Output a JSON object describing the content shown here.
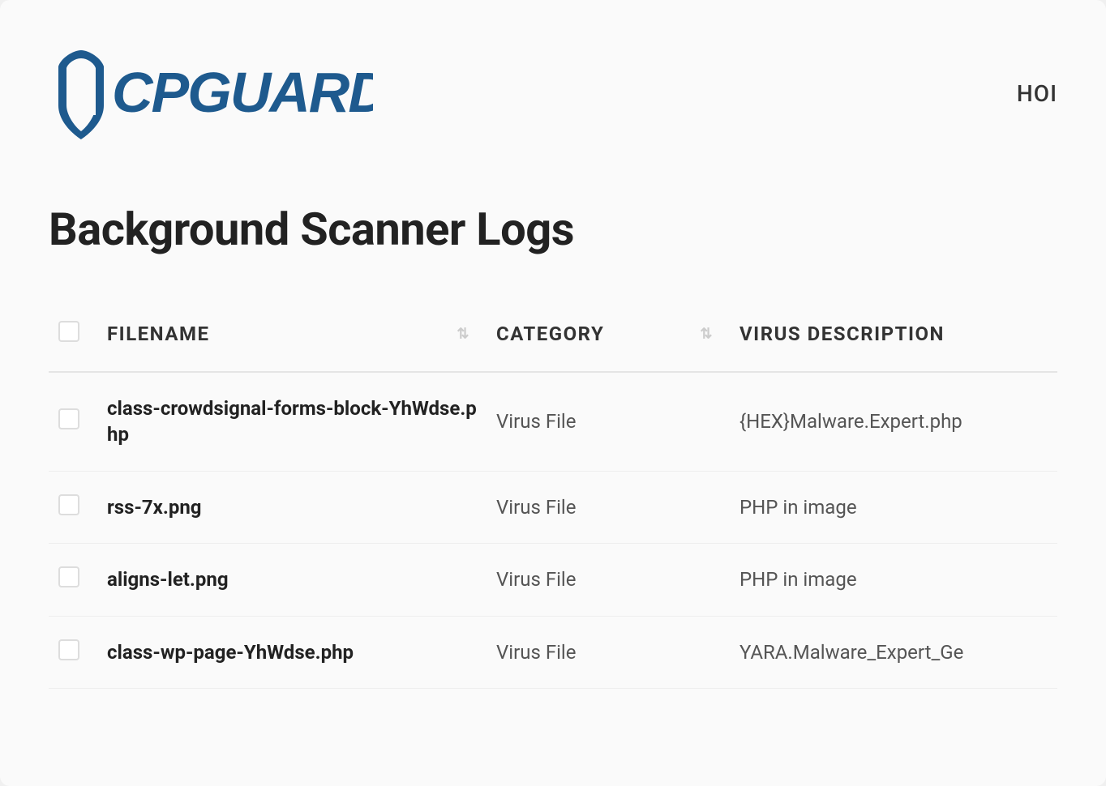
{
  "brand": {
    "name": "cPGuard"
  },
  "nav": {
    "home": "HOI"
  },
  "page": {
    "title": "Background Scanner Logs"
  },
  "table": {
    "headers": {
      "filename": "FILENAME",
      "category": "CATEGORY",
      "virus": "VIRUS DESCRIPTION"
    },
    "rows": [
      {
        "filename": "class-crowdsignal-forms-block-YhWdse.php",
        "category": "Virus File",
        "virus": "{HEX}Malware.Expert.php"
      },
      {
        "filename": "rss-7x.png",
        "category": "Virus File",
        "virus": "PHP in image"
      },
      {
        "filename": "aligns-let.png",
        "category": "Virus File",
        "virus": "PHP in image"
      },
      {
        "filename": "class-wp-page-YhWdse.php",
        "category": "Virus File",
        "virus": "YARA.Malware_Expert_Ge"
      }
    ]
  }
}
